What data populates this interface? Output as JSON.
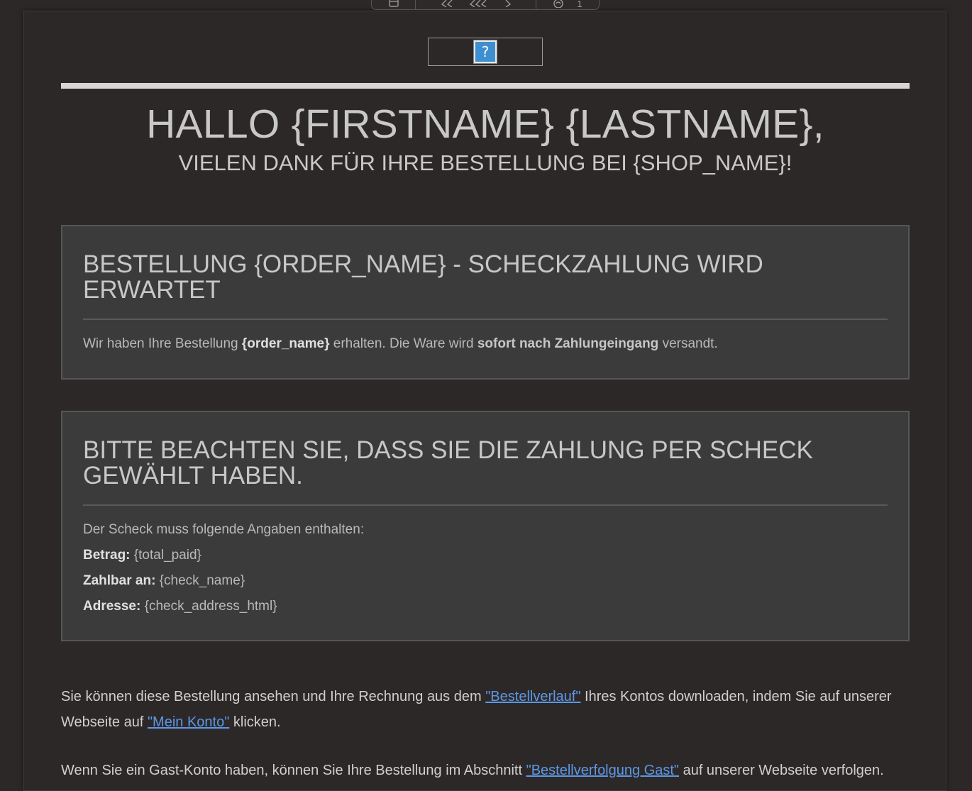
{
  "toolbar": {
    "groups": [
      {
        "icons": [
          "calendar-icon"
        ]
      },
      {
        "icons": [
          "reply-icon",
          "reply-all-icon",
          "forward-icon"
        ]
      },
      {
        "icons": [
          "attachment-icon"
        ],
        "count": "1"
      }
    ]
  },
  "email": {
    "logo_placeholder": "?",
    "greeting": "HALLO {FIRSTNAME} {LASTNAME},",
    "thanks": "VIELEN DANK FÜR IHRE BESTELLUNG BEI {SHOP_NAME}!",
    "order_box": {
      "title": "BESTELLUNG {ORDER_NAME} - SCHECKZAHLUNG WIRD ERWARTET",
      "text_1": "Wir haben Ihre Bestellung ",
      "order_name": "{order_name}",
      "text_2": " erhalten. Die Ware wird ",
      "highlight": "sofort nach Zahlungeingang",
      "text_3": " versandt."
    },
    "check_box": {
      "title": "BITTE BEACHTEN SIE, DASS SIE DIE ZAHLUNG PER SCHECK GEWÄHLT HABEN.",
      "intro": "Der Scheck muss folgende Angaben enthalten:",
      "fields": [
        {
          "label": "Betrag:",
          "value": " {total_paid}"
        },
        {
          "label": "Zahlbar an:",
          "value": " {check_name}"
        },
        {
          "label": "Adresse:",
          "value": " {check_address_html}"
        }
      ]
    },
    "history": {
      "text_1": "Sie können diese Bestellung ansehen und Ihre Rechnung aus dem ",
      "link_1": "\"Bestellverlauf\"",
      "text_2": " Ihres Kontos downloaden, indem Sie auf unserer Webseite auf ",
      "link_2": "\"Mein Konto\"",
      "text_3": " klicken."
    },
    "guest": {
      "text_1": "Wenn Sie ein Gast-Konto haben, können Sie Ihre Bestellung im Abschnitt ",
      "link": "\"Bestellverfolgung Gast\"",
      "text_2": " auf unserer Webseite verfolgen."
    }
  }
}
